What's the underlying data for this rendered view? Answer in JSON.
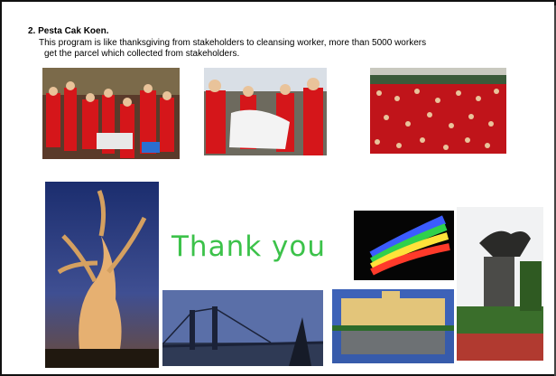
{
  "slide": {
    "heading": "2. Pesta Cak Koen.",
    "body_line1": "This program is like thanksgiving from stakeholders to cleansing worker, more than 5000 workers",
    "body_line2": "get the parcel which collected from stakeholders.",
    "thank_you": "Thank you"
  },
  "colors": {
    "thank_you_text": "#3cc24a",
    "crowd_red": "#d5161a",
    "frame_border": "#111111"
  }
}
